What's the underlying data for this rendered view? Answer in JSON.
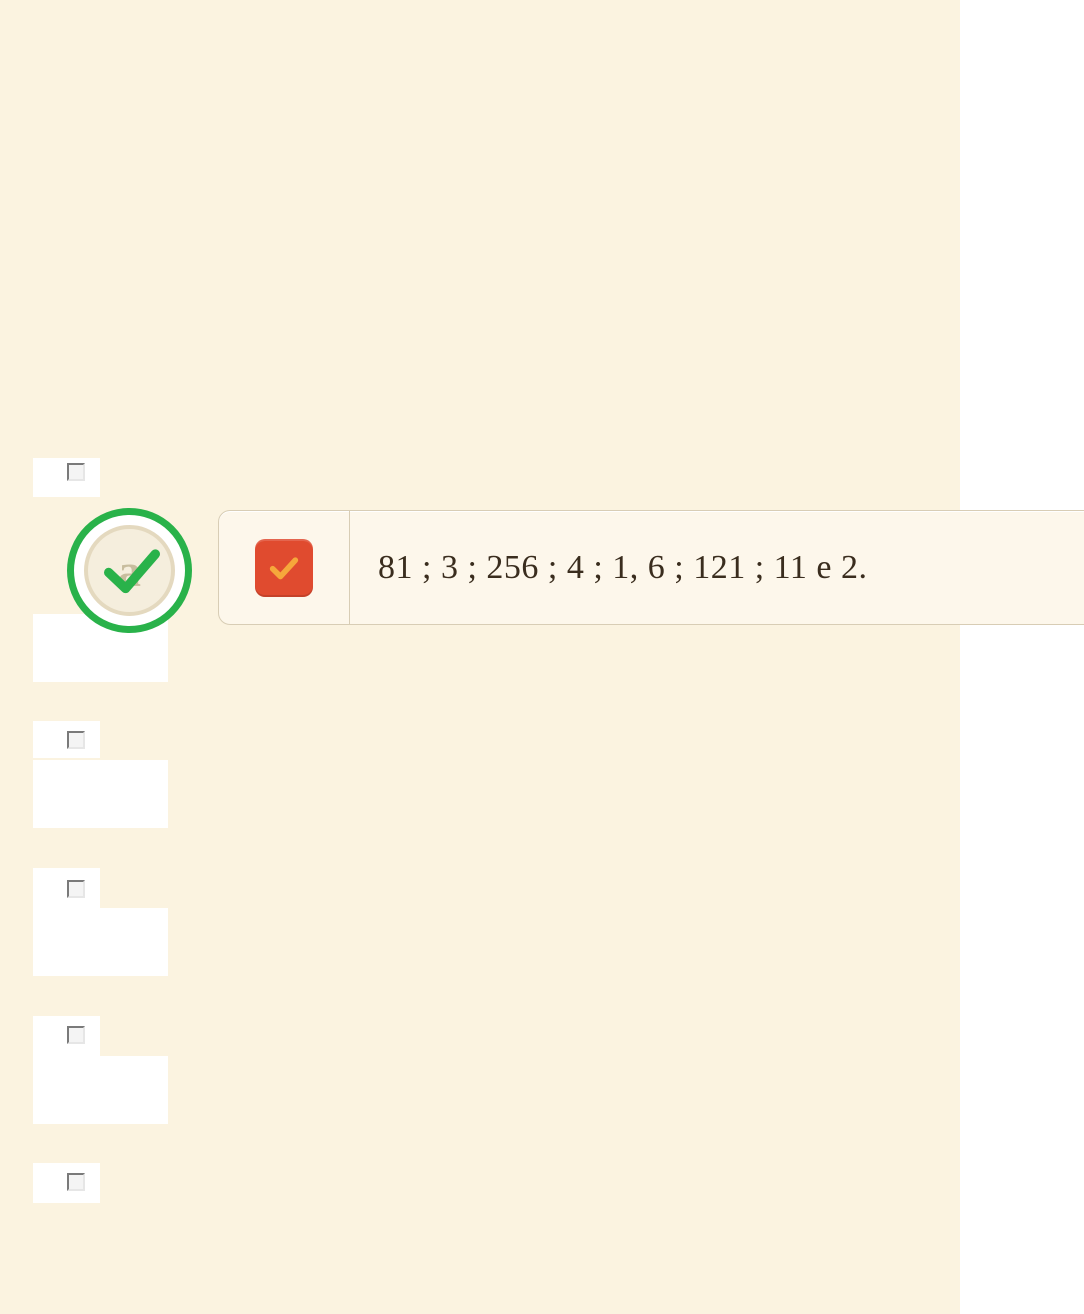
{
  "answer": {
    "option_letter": "a",
    "text": "81 ;  3 ;  256 ;  4 ;  1, 6 ;  121 ;  11 e 2."
  },
  "items": [
    {
      "checked": false
    },
    {
      "checked": false
    },
    {
      "checked": false
    },
    {
      "checked": false
    },
    {
      "checked": false
    }
  ]
}
